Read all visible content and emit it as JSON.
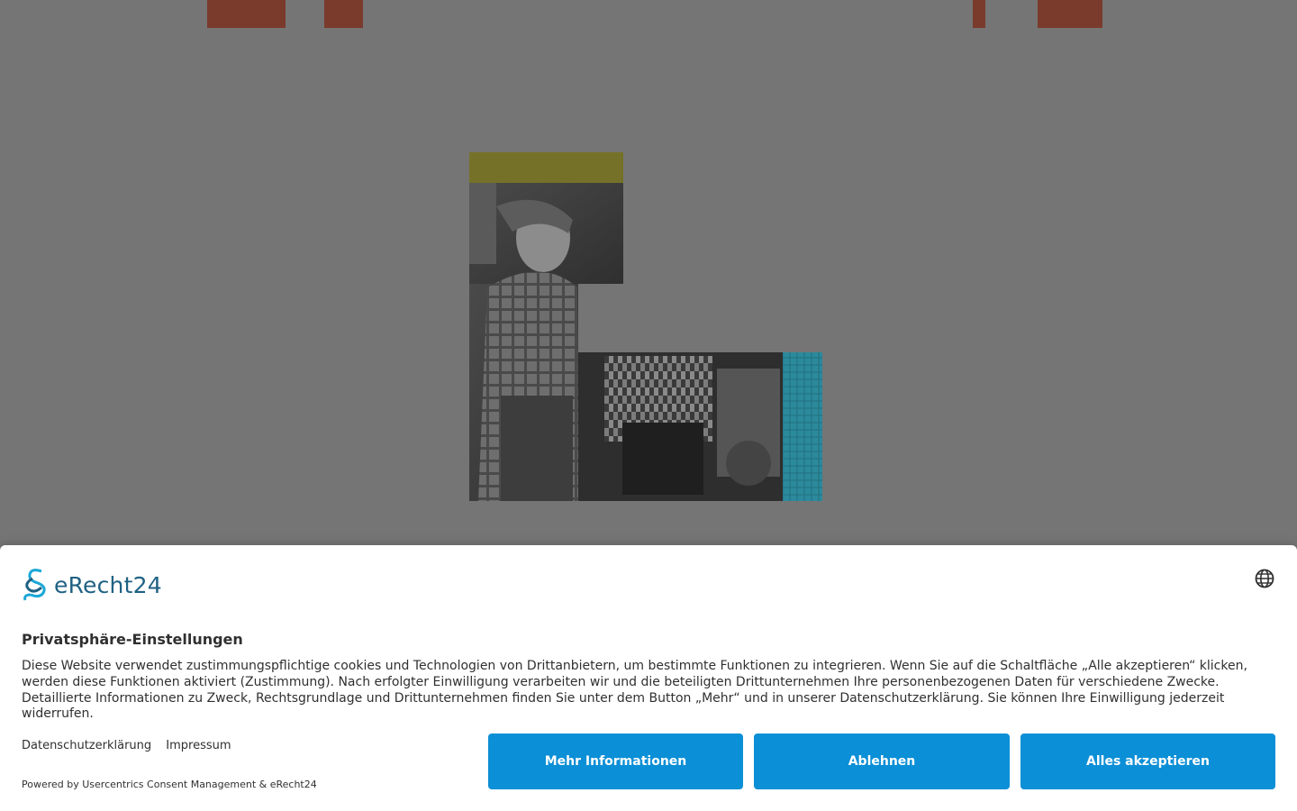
{
  "consent": {
    "logo_text": "eRecht24",
    "title": "Privatsphäre-Einstellungen",
    "description": "Diese Website verwendet zustimmungspflichtige cookies und Technologien von Drittanbietern, um bestimmte Funktionen zu integrieren. Wenn Sie auf die Schaltfläche „Alle akzeptieren“ klicken, werden diese Funktionen aktiviert (Zustimmung). Nach erfolgter Einwilligung verarbeiten wir und die beteiligten Drittunternehmen Ihre personenbezogenen Daten für verschiedene Zwecke. Detaillierte Informationen zu Zweck, Rechtsgrundlage und Drittunternehmen finden Sie unter dem Button „Mehr“ und in unserer Datenschutzerklärung. Sie können Ihre Einwilligung jederzeit widerrufen.",
    "links": {
      "privacy": "Datenschutzerklärung",
      "imprint": "Impressum"
    },
    "powered_by": "Powered by Usercentrics Consent Management & eRecht24",
    "buttons": {
      "more": "Mehr Informationen",
      "deny": "Ablehnen",
      "accept": "Alles akzeptieren"
    },
    "accent_color": "#0b8fd6",
    "language_icon": "globe-icon"
  },
  "background": {
    "overlay_color": "#757575",
    "accent_blocks_color": "#7a3a2c",
    "collage_colors": [
      "#757128",
      "#2b8a9c"
    ]
  }
}
